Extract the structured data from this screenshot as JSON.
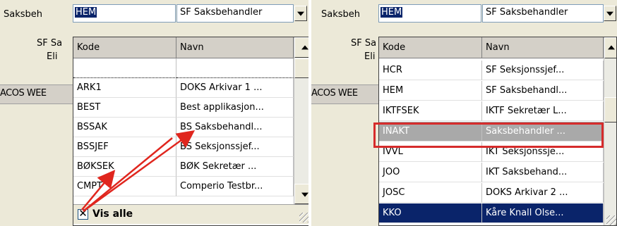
{
  "left": {
    "bg_label_saksbeh": "Saksbeh",
    "bg_label_sfsa": "SF Sa",
    "bg_label_eli": "Eli",
    "bg_label_acos": "ACOS WEE",
    "code_field_value": "HEM",
    "name_field_value": "SF Saksbehandler",
    "columns": [
      "Kode",
      "Navn"
    ],
    "rows": [
      {
        "code": "",
        "name": ""
      },
      {
        "code": "ARK1",
        "name": "DOKS Arkivar 1 ..."
      },
      {
        "code": "BEST",
        "name": "Best applikasjon..."
      },
      {
        "code": "BSSAK",
        "name": "BS Saksbehandl..."
      },
      {
        "code": "BSSJEF",
        "name": "BS Seksjonssjef..."
      },
      {
        "code": "BØKSEK",
        "name": "BØK Sekretær  ..."
      },
      {
        "code": "CMPT",
        "name": "Comperio Testbr..."
      }
    ],
    "footer_checkbox": "✕",
    "footer_label": "Vis alle"
  },
  "right": {
    "bg_label_saksbeh": "Saksbeh",
    "bg_label_sfsa": "SF Sa",
    "bg_label_eli": "Eli",
    "bg_label_acos": "ACOS WEE",
    "code_field_value": "HEM",
    "name_field_value": "SF Saksbehandler",
    "columns": [
      "Kode",
      "Navn"
    ],
    "rows": [
      {
        "code": "HCR",
        "name": "SF Seksjonssjef..."
      },
      {
        "code": "HEM",
        "name": "SF Saksbehandl..."
      },
      {
        "code": "IKTFSEK",
        "name": "IKTF Sekretær L..."
      },
      {
        "code": "INAKT",
        "name": "Saksbehandler ..."
      },
      {
        "code": "IVVL",
        "name": "IKT Seksjonssje..."
      },
      {
        "code": "JOO",
        "name": "IKT Saksbehand..."
      },
      {
        "code": "JOSC",
        "name": "DOKS Arkivar 2 ..."
      },
      {
        "code": "KKO",
        "name": "Kåre Knall Olse..."
      }
    ]
  },
  "colors": {
    "selection": "#0a246a",
    "inactive_row": "#a9a9a9",
    "annotation_red": "#d62b2b"
  }
}
